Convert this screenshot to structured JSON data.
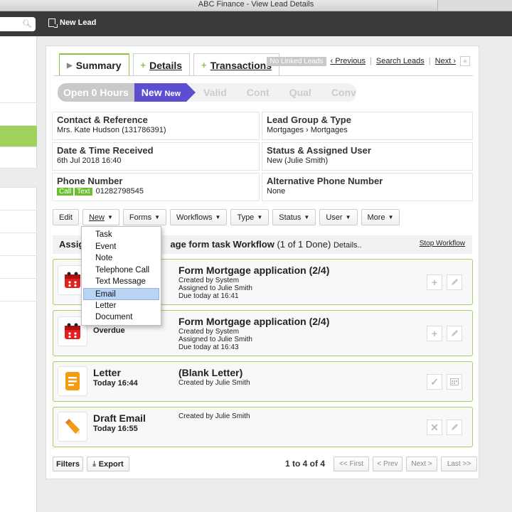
{
  "window": {
    "title": "ABC Finance - View Lead Details"
  },
  "topbar": {
    "new_lead_label": "New Lead",
    "search_placeholder": ""
  },
  "tabs": [
    {
      "label": "Summary",
      "active": true
    },
    {
      "label": "Details",
      "active": false
    },
    {
      "label": "Transactions",
      "active": false
    }
  ],
  "top_links": {
    "linked_badge": "No Linked Leads",
    "previous": "‹ Previous",
    "search": "Search Leads",
    "next": "Next ›"
  },
  "stages": [
    {
      "label": "Open 0 Hours",
      "state": "done"
    },
    {
      "label": "New",
      "suffix": "New",
      "state": "current"
    },
    {
      "label": "Valid",
      "state": "future"
    },
    {
      "label": "Cont",
      "state": "future"
    },
    {
      "label": "Qual",
      "state": "future"
    },
    {
      "label": "Conv",
      "state": "future"
    }
  ],
  "info": {
    "contact_title": "Contact & Reference",
    "contact_value": "Mrs. Kate Hudson (131786391)",
    "group_title": "Lead Group & Type",
    "group_value": "Mortgages › Mortgages",
    "received_title": "Date & Time Received",
    "received_value": "6th Jul 2018 16:40",
    "status_title": "Status & Assigned User",
    "status_value": "New (Julie Smith)",
    "phone_title": "Phone Number",
    "phone_call_tag": "Call",
    "phone_text_tag": "Text",
    "phone_value": "01282798545",
    "alt_phone_title": "Alternative Phone Number",
    "alt_phone_value": "None"
  },
  "actions": {
    "edit": "Edit",
    "new": "New",
    "forms": "Forms",
    "workflows": "Workflows",
    "type": "Type",
    "status": "Status",
    "user": "User",
    "more": "More"
  },
  "new_menu": {
    "items": [
      "Task",
      "Event",
      "Note",
      "Telephone Call",
      "Text Message",
      "Email",
      "Letter",
      "Document"
    ],
    "highlighted": "Email"
  },
  "workflow": {
    "prefix": "Assig",
    "name": "age form task Workflow",
    "progress": "(1 of 1 Done)",
    "details": "Details..",
    "stop": "Stop Workflow"
  },
  "cards": [
    {
      "icon": "calendar-icon",
      "name": "",
      "when": "",
      "title": "Form Mortgage application (2/4)",
      "created": "Created by System",
      "assigned": "Assigned to Julie Smith",
      "due": "Due today at 16:41"
    },
    {
      "icon": "calendar-icon",
      "name": "",
      "when": "Overdue",
      "title": "Form Mortgage application (2/4)",
      "created": "Created by System",
      "assigned": "Assigned to Julie Smith",
      "due": "Due today at 16:43"
    },
    {
      "icon": "letter-icon",
      "name": "Letter",
      "when": "Today 16:44",
      "title": "(Blank Letter)",
      "created": "Created by Julie Smith"
    },
    {
      "icon": "pencil-icon",
      "name": "Draft Email",
      "when": "Today 16:55",
      "title": "",
      "created": "Created by Julie Smith"
    }
  ],
  "footer": {
    "filters": "Filters",
    "export": "Export",
    "count": "1 to 4 of 4",
    "first": "<< First",
    "prev": "< Prev",
    "next": "Next >",
    "last": "Last >>"
  },
  "colors": {
    "accent_green": "#8cc63f",
    "stage_purple": "#5b4ed1",
    "topbar": "#3a3a3a"
  }
}
